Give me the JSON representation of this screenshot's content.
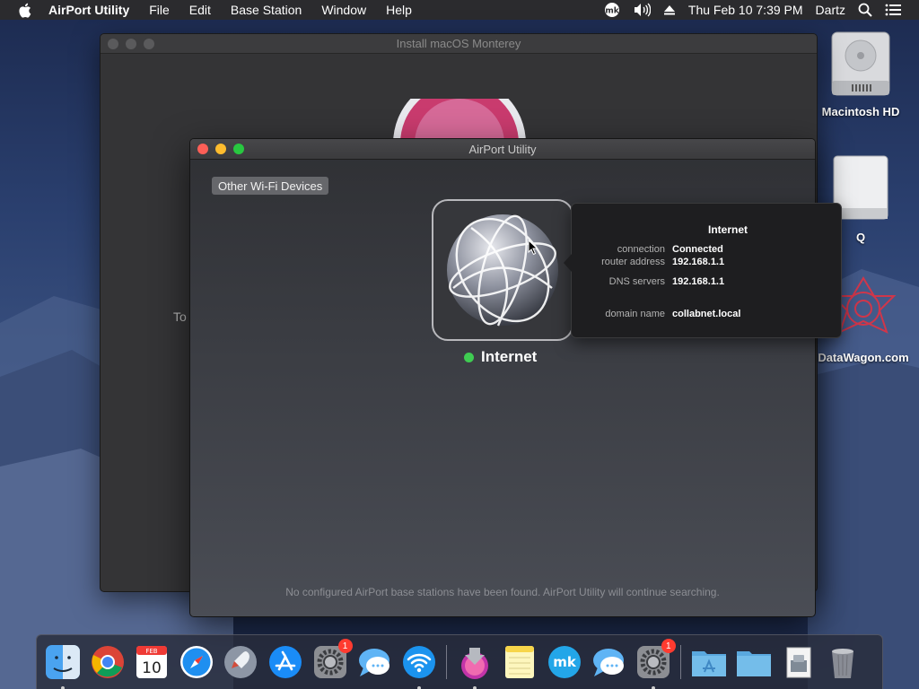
{
  "menubar": {
    "app_name": "AirPort Utility",
    "menus": [
      "File",
      "Edit",
      "Base Station",
      "Window",
      "Help"
    ],
    "clock": "Thu Feb 10  7:39 PM",
    "user": "Dartz"
  },
  "desktop": {
    "icons": [
      {
        "label": "Macintosh HD"
      },
      {
        "label": "Q"
      },
      {
        "label": "DataWagon.com"
      }
    ]
  },
  "background_window": {
    "title": "Install macOS Monterey",
    "side_text": "To"
  },
  "airport_window": {
    "title": "AirPort Utility",
    "wifi_button": "Other Wi-Fi Devices",
    "internet_label": "Internet",
    "status_text": "No configured AirPort base stations have been found. AirPort Utility will continue searching.",
    "status_color": "#3fcc52"
  },
  "popover": {
    "title": "Internet",
    "rows": [
      {
        "key": "connection",
        "value": "Connected"
      },
      {
        "key": "router address",
        "value": "192.168.1.1"
      },
      {
        "key": "DNS servers",
        "value": "192.168.1.1"
      },
      {
        "key": "domain name",
        "value": "collabnet.local"
      }
    ]
  },
  "dock": {
    "calendar_month": "FEB",
    "calendar_day": "10",
    "badges": {
      "system_prefs": "1",
      "software_update": "1"
    },
    "items": [
      "finder-icon",
      "chrome-icon",
      "calendar-icon",
      "safari-icon",
      "launchpad-icon",
      "app-store-icon",
      "system-preferences-icon",
      "messages-icon",
      "wifi-diagnostics-icon",
      "install-macos-icon",
      "notes-icon",
      "mk-app-icon",
      "messages-2-icon",
      "software-update-icon",
      "applications-folder-icon",
      "downloads-folder-icon",
      "preview-icon",
      "trash-icon"
    ]
  }
}
